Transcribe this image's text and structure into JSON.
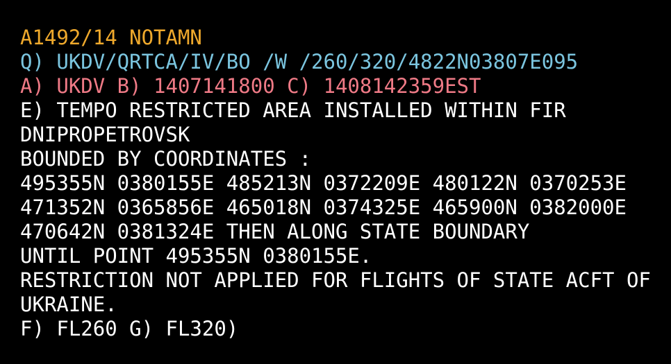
{
  "window": {
    "title": "A1492/14 NOTAMN",
    "background_color": "#000000"
  },
  "colors": {
    "notam_id": "#efa92c",
    "q_line": "#7bc5df",
    "ab_line": "#ef7a86",
    "body": "#ffffff",
    "background": "#000000"
  },
  "notam": {
    "id_line": "A1492/14 NOTAMN",
    "q_line": "Q) UKDV/QRTCA/IV/BO /W /260/320/4822N03807E095",
    "ab_line": "A) UKDV B) 1407141800 C) 1408142359EST",
    "lines": [
      {
        "id": "id-line",
        "style": "c-id",
        "text": "A1492/14 NOTAMN"
      },
      {
        "id": "q-line",
        "style": "c-qline",
        "text": "Q) UKDV/QRTCA/IV/BO /W /260/320/4822N03807E095"
      },
      {
        "id": "ab-line",
        "style": "c-abline",
        "text": "A) UKDV B) 1407141800 C) 1408142359EST"
      },
      {
        "id": "e-line-1",
        "style": "c-body",
        "text": "E) TEMPO RESTRICTED AREA INSTALLED WITHIN FIR"
      },
      {
        "id": "e-line-2",
        "style": "c-body",
        "text": "DNIPROPETROVSK"
      },
      {
        "id": "e-line-3",
        "style": "c-body",
        "text": "BOUNDED BY COORDINATES :"
      },
      {
        "id": "coord-row-1",
        "style": "c-body",
        "text": "495355N 0380155E 485213N 0372209E 480122N 0370253E"
      },
      {
        "id": "coord-row-2",
        "style": "c-body",
        "text": "471352N 0365856E 465018N 0374325E 465900N 0382000E"
      },
      {
        "id": "coord-row-3",
        "style": "c-body",
        "text": "470642N 0381324E THEN ALONG STATE BOUNDARY"
      },
      {
        "id": "coord-row-4",
        "style": "c-body",
        "text": "UNTIL POINT 495355N 0380155E."
      },
      {
        "id": "e-line-4",
        "style": "c-body",
        "text": "RESTRICTION NOT APPLIED FOR FLIGHTS OF STATE ACFT OF"
      },
      {
        "id": "e-line-5",
        "style": "c-body",
        "text": "UKRAINE."
      },
      {
        "id": "fg-line",
        "style": "c-body",
        "text": "F) FL260 G) FL320)"
      }
    ],
    "fields": {
      "a_field": "UKDV",
      "b_field": "1407141800",
      "c_field": "1408142359EST",
      "f_field": "FL260",
      "g_field": "FL320",
      "lower_limit": "260",
      "upper_limit": "320",
      "radius": "095",
      "center": "4822N03807E",
      "fir": "UKDV",
      "q_code": "QRTCA",
      "traffic": "IV",
      "purpose": "BO",
      "scope": "W"
    },
    "coordinates": [
      "495355N 0380155E",
      "485213N 0372209E",
      "480122N 0370253E",
      "471352N 0365856E",
      "465018N 0374325E",
      "465900N 0382000E",
      "470642N 0381324E"
    ]
  }
}
